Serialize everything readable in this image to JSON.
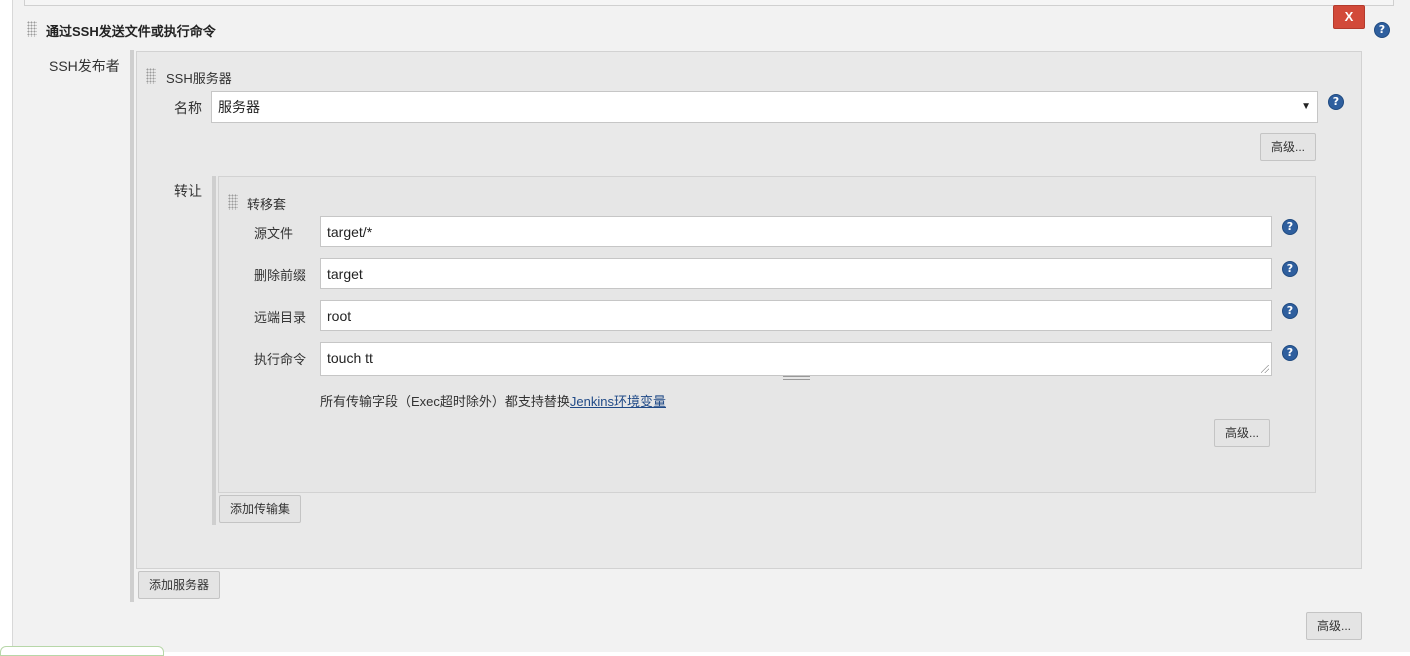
{
  "section": {
    "title": "通过SSH发送文件或执行命令",
    "delete_label": "X",
    "help_label": "?"
  },
  "publisher": {
    "label": "SSH发布者",
    "server_block_title": "SSH服务器",
    "name_label": "名称",
    "name_value": "服务器",
    "advanced_label": "高级..."
  },
  "transfer": {
    "label": "转让",
    "set_title": "转移套",
    "fields": [
      {
        "label": "源文件",
        "value": "target/*"
      },
      {
        "label": "删除前缀",
        "value": "target"
      },
      {
        "label": "远端目录",
        "value": "root"
      },
      {
        "label": "执行命令",
        "value": "touch tt"
      }
    ],
    "note_prefix": "所有传输字段（Exec超时除外）都支持替换",
    "note_link": "Jenkins环境变量",
    "advanced_label": "高级...",
    "add_set_label": "添加传输集"
  },
  "add_server_label": "添加服务器",
  "bottom_advanced_label": "高级..."
}
